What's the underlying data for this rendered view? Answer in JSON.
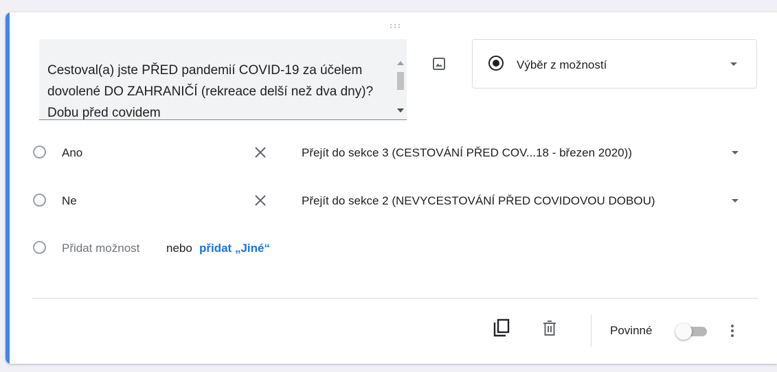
{
  "colors": {
    "accent": "#4285f4",
    "link": "#1a73e8",
    "icon": "#5f6368",
    "placeholder": "#70757a"
  },
  "question": {
    "text": "Cestoval(a) jste PŘED pandemií COVID-19 za účelem dovolené DO ZAHRANIČÍ (rekreace delší než dva dny)? Dobu před covidem"
  },
  "type_select": {
    "label": "Výběr z možností",
    "icon": "radio-checked-icon"
  },
  "options": [
    {
      "label": "Ano",
      "section": "Přejít do sekce 3 (CESTOVÁNÍ PŘED COV...18 - březen 2020))"
    },
    {
      "label": "Ne",
      "section": "Přejít do sekce 2 (NEVYCESTOVÁNÍ PŘED COVIDOVOU DOBOU)"
    }
  ],
  "add_option": {
    "placeholder": "Přidat možnost",
    "or_label": "nebo",
    "add_other": "přidat „Jiné“"
  },
  "footer": {
    "required_label": "Povinné",
    "required_on": false
  }
}
